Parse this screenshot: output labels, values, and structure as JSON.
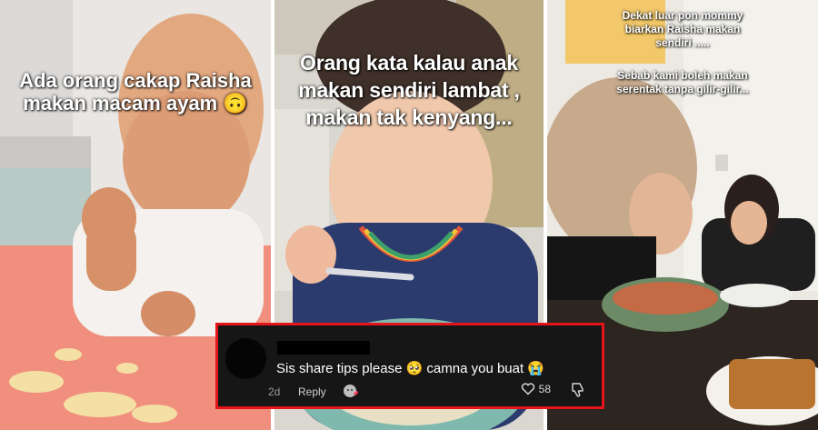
{
  "panels": [
    {
      "caption_lines": [
        "Ada orang cakap Raisha",
        "makan macam ayam 🙃"
      ]
    },
    {
      "caption_lines": [
        "Orang kata kalau anak",
        "makan sendiri lambat ,",
        "makan tak kenyang..."
      ]
    },
    {
      "caption_top_lines": [
        "Dekat luar pon mommy",
        "biarkan Raisha makan",
        "sendiri ....."
      ],
      "caption_bottom_lines": [
        "Sebab kami boleh makan",
        "serentak tanpa gilir-gilir..."
      ]
    }
  ],
  "comment": {
    "text": "Sis share tips please 🥺 camna you buat 😭",
    "time": "2d",
    "reply_label": "Reply",
    "like_count": "58"
  },
  "colors": {
    "comment_border": "#e4141b",
    "comment_bg": "#161616"
  },
  "icons": [
    "avatar",
    "reaction-sticker-icon",
    "heart-icon",
    "dislike-icon"
  ]
}
